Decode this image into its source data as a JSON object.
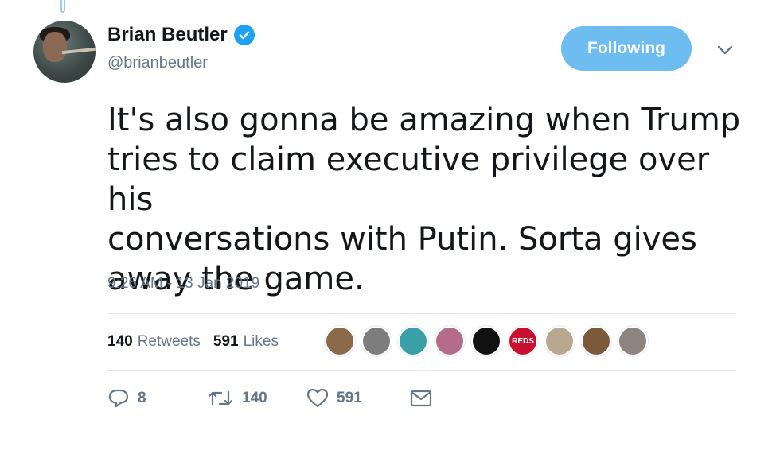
{
  "author": {
    "display_name": "Brian Beutler",
    "handle": "@brianbeutler",
    "verified": true
  },
  "follow_button": {
    "label": "Following"
  },
  "tweet": {
    "text": "It's also gonna be amazing when Trump\ntries to claim executive privilege over his\nconversations with Putin. Sorta gives\naway the game.",
    "timestamp": "9:26 AM - 13 Jan 2019"
  },
  "stats": {
    "retweets_count": "140",
    "retweets_label": "Retweets",
    "likes_count": "591",
    "likes_label": "Likes"
  },
  "likers": [
    {
      "color": "#8a6a4a"
    },
    {
      "color": "#7d7d7d"
    },
    {
      "color": "#3aa0a8"
    },
    {
      "color": "#b56b8a"
    },
    {
      "color": "#111111"
    },
    {
      "color": "#c8102e",
      "text": "REDS"
    },
    {
      "color": "#b8a890"
    },
    {
      "color": "#7a5a3a"
    },
    {
      "color": "#8d8480"
    }
  ],
  "actions": {
    "reply_count": "8",
    "retweet_count": "140",
    "like_count": "591"
  },
  "colors": {
    "accent": "#1da1f2",
    "follow_button_bg": "#6dbdf0",
    "muted_text": "#657786"
  }
}
